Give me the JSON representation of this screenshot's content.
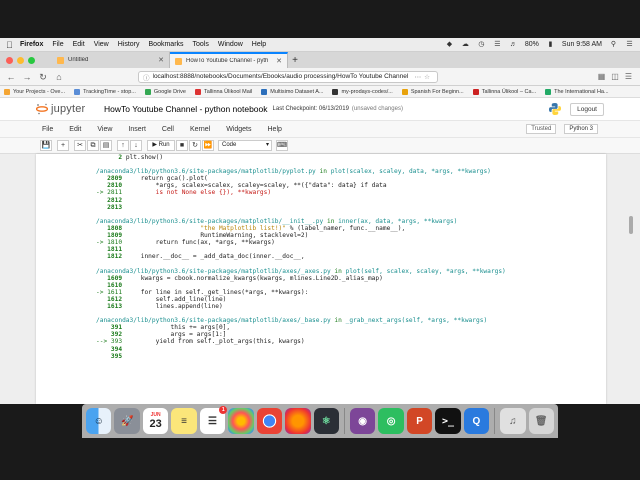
{
  "os_menu": {
    "app_name": "Firefox",
    "items": [
      "File",
      "Edit",
      "View",
      "History",
      "Bookmarks",
      "Tools",
      "Window",
      "Help"
    ],
    "battery": "80%",
    "clock": "Sun 9:58 AM"
  },
  "browser": {
    "tabs": [
      {
        "label": "Untitled",
        "active": false
      },
      {
        "label": "HowTo Youtube Channel - pyth",
        "active": true
      }
    ],
    "url": "localhost:8888/notebooks/Documents/Ebooks/audio processing/HowTo Youtube Channel",
    "bookmarks": [
      {
        "label": "Your Projects - Ove...",
        "color": "#f4a533"
      },
      {
        "label": "TrackingTime - stop...",
        "color": "#5a8dd6"
      },
      {
        "label": "Google Drive",
        "color": "#34a853"
      },
      {
        "label": "Tallinna Ülikool Mail",
        "color": "#d33"
      },
      {
        "label": "Multisimo Dataset A...",
        "color": "#2c6fbb"
      },
      {
        "label": "my-prodays-codes/...",
        "color": "#333"
      },
      {
        "label": "Spanish For Beginn...",
        "color": "#e8a20c"
      },
      {
        "label": "Tallinna Ülikool – Ca...",
        "color": "#c22"
      },
      {
        "label": "The International Ha...",
        "color": "#2a6"
      }
    ]
  },
  "jupyter": {
    "logo_text": "jupyter",
    "notebook_title": "HowTo Youtube Channel - python notebook",
    "checkpoint": "Last Checkpoint: 06/13/2019",
    "unsaved": "(unsaved changes)",
    "logout": "Logout",
    "menu": [
      "File",
      "Edit",
      "View",
      "Insert",
      "Cell",
      "Kernel",
      "Widgets",
      "Help"
    ],
    "trusted": "Trusted",
    "kernel": "Python 3",
    "toolbar": {
      "run_label": "Run",
      "cell_type": "Code"
    }
  },
  "traceback": [
    [
      {
        "t": "      2 ",
        "c": "c-lnum"
      },
      {
        "t": "plt.show()",
        "c": ""
      }
    ],
    [
      {
        "t": "",
        "c": ""
      }
    ],
    [
      {
        "t": "/anaconda3/lib/python3.6/site-packages/matplotlib/pyplot.py",
        "c": "c-file"
      },
      {
        "t": " in ",
        "c": "c-in"
      },
      {
        "t": "plot",
        "c": "c-func"
      },
      {
        "t": "(scalex, scaley, data, *args, **kwargs)",
        "c": "c-func"
      }
    ],
    [
      {
        "t": "   2809 ",
        "c": "c-lnum"
      },
      {
        "t": "    return gca().plot(",
        "c": ""
      }
    ],
    [
      {
        "t": "   2810 ",
        "c": "c-lnum"
      },
      {
        "t": "        *args, scalex=scalex, scaley=scaley, **({\"data\": data} if data",
        "c": ""
      }
    ],
    [
      {
        "t": "-> 2811 ",
        "c": "c-arrow"
      },
      {
        "t": "        is not None else {}), **kwargs)",
        "c": "c-red"
      }
    ],
    [
      {
        "t": "   2812 ",
        "c": "c-lnum"
      },
      {
        "t": "",
        "c": ""
      }
    ],
    [
      {
        "t": "   2813 ",
        "c": "c-lnum"
      },
      {
        "t": "",
        "c": ""
      }
    ],
    [
      {
        "t": "",
        "c": ""
      }
    ],
    [
      {
        "t": "/anaconda3/lib/python3.6/site-packages/matplotlib/__init__.py",
        "c": "c-file"
      },
      {
        "t": " in ",
        "c": "c-in"
      },
      {
        "t": "inner",
        "c": "c-func"
      },
      {
        "t": "(ax, data, *args, **kwargs)",
        "c": "c-func"
      }
    ],
    [
      {
        "t": "   1808 ",
        "c": "c-lnum"
      },
      {
        "t": "                    ",
        "c": ""
      },
      {
        "t": "\"the Matplotlib list!)\"",
        "c": "c-str"
      },
      {
        "t": " % (label_namer, func.__name__),",
        "c": ""
      }
    ],
    [
      {
        "t": "   1809 ",
        "c": "c-lnum"
      },
      {
        "t": "                    RuntimeWarning, stacklevel=2)",
        "c": ""
      }
    ],
    [
      {
        "t": "-> 1810 ",
        "c": "c-arrow"
      },
      {
        "t": "        return func(ax, *args, **kwargs)",
        "c": ""
      }
    ],
    [
      {
        "t": "   1811 ",
        "c": "c-lnum"
      },
      {
        "t": "",
        "c": ""
      }
    ],
    [
      {
        "t": "   1812 ",
        "c": "c-lnum"
      },
      {
        "t": "    inner.__doc__ = _add_data_doc(inner.__doc__,",
        "c": ""
      }
    ],
    [
      {
        "t": "",
        "c": ""
      }
    ],
    [
      {
        "t": "/anaconda3/lib/python3.6/site-packages/matplotlib/axes/_axes.py",
        "c": "c-file"
      },
      {
        "t": " in ",
        "c": "c-in"
      },
      {
        "t": "plot",
        "c": "c-func"
      },
      {
        "t": "(self, scalex, scaley, *args, **kwargs)",
        "c": "c-func"
      }
    ],
    [
      {
        "t": "   1609 ",
        "c": "c-lnum"
      },
      {
        "t": "    kwargs = cbook.normalize_kwargs(kwargs, mlines.Line2D._alias_map)",
        "c": ""
      }
    ],
    [
      {
        "t": "   1610 ",
        "c": "c-lnum"
      },
      {
        "t": "",
        "c": ""
      }
    ],
    [
      {
        "t": "-> 1611 ",
        "c": "c-arrow"
      },
      {
        "t": "    for line in self._get_lines(*args, **kwargs):",
        "c": ""
      }
    ],
    [
      {
        "t": "   1612 ",
        "c": "c-lnum"
      },
      {
        "t": "        self.add_line(line)",
        "c": ""
      }
    ],
    [
      {
        "t": "   1613 ",
        "c": "c-lnum"
      },
      {
        "t": "        lines.append(line)",
        "c": ""
      }
    ],
    [
      {
        "t": "",
        "c": ""
      }
    ],
    [
      {
        "t": "/anaconda3/lib/python3.6/site-packages/matplotlib/axes/_base.py",
        "c": "c-file"
      },
      {
        "t": " in ",
        "c": "c-in"
      },
      {
        "t": "_grab_next_args",
        "c": "c-func"
      },
      {
        "t": "(self, *args, **kwargs)",
        "c": "c-func"
      }
    ],
    [
      {
        "t": "    391 ",
        "c": "c-lnum"
      },
      {
        "t": "            this += args[0],",
        "c": ""
      }
    ],
    [
      {
        "t": "    392 ",
        "c": "c-lnum"
      },
      {
        "t": "            args = args[1:]",
        "c": ""
      }
    ],
    [
      {
        "t": "--> 393 ",
        "c": "c-arrow"
      },
      {
        "t": "        yield from self._plot_args(this, kwargs)",
        "c": ""
      }
    ],
    [
      {
        "t": "    394 ",
        "c": "c-lnum"
      },
      {
        "t": "",
        "c": ""
      }
    ],
    [
      {
        "t": "    395 ",
        "c": "c-lnum"
      },
      {
        "t": "",
        "c": ""
      }
    ]
  ],
  "dock": {
    "calendar_day": "23",
    "calendar_month": "JUN",
    "badge_count": "1"
  }
}
